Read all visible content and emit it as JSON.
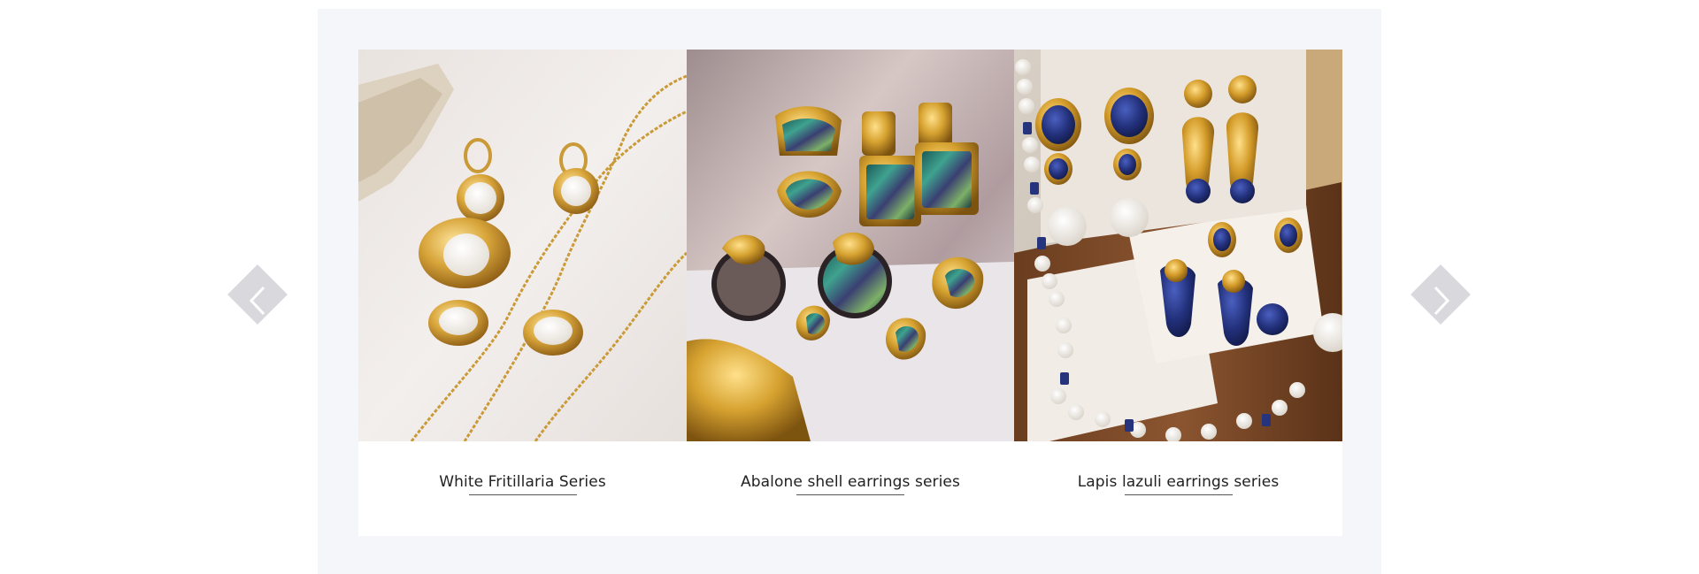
{
  "carousel": {
    "prev_icon": "chevron-left-icon",
    "next_icon": "chevron-right-icon",
    "items": [
      {
        "caption": "White Fritillaria Series",
        "image_subject": "gold earrings, ring and necklaces with white shell inlays"
      },
      {
        "caption": "Abalone shell earrings series",
        "image_subject": "gold earrings with iridescent abalone shell on a shell plate"
      },
      {
        "caption": "Lapis lazuli earrings series",
        "image_subject": "gold earrings with blue lapis stones and pearls in a wooden jewelry box"
      }
    ]
  },
  "colors": {
    "panel_background": "#f5f6f9",
    "arrow_background": "#d9d9dd",
    "caption_text": "#222222"
  }
}
